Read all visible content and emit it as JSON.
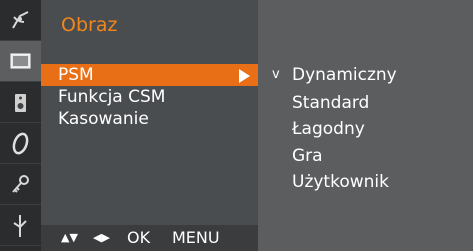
{
  "menu": {
    "title": "Obraz",
    "items": [
      {
        "label": "PSM",
        "selected": true
      },
      {
        "label": "Funkcja CSM",
        "selected": false
      },
      {
        "label": "Kasowanie",
        "selected": false
      }
    ]
  },
  "submenu": {
    "check_mark": "v",
    "options": [
      {
        "label": "Dynamiczny",
        "checked": true
      },
      {
        "label": "Standard",
        "checked": false
      },
      {
        "label": "Łagodny",
        "checked": false
      },
      {
        "label": "Gra",
        "checked": false
      },
      {
        "label": "Użytkownik",
        "checked": false
      }
    ]
  },
  "navbar": {
    "updown": "▲▼",
    "leftright": "◀▶",
    "ok": "OK",
    "menu": "MENU"
  },
  "side_icons": [
    {
      "icon": "satellite-dish-icon",
      "selected": false
    },
    {
      "icon": "screen-icon",
      "selected": true
    },
    {
      "icon": "speaker-icon",
      "selected": false
    },
    {
      "icon": "clock-icon",
      "selected": false
    },
    {
      "icon": "key-icon",
      "selected": false
    },
    {
      "icon": "antenna-icon",
      "selected": false
    }
  ],
  "colors": {
    "title": "#f0861d",
    "highlight": "#e86f16",
    "panel": "#4a4d50",
    "submenu": "#5b5d5f",
    "icon_strip": "#2a2c2e"
  }
}
